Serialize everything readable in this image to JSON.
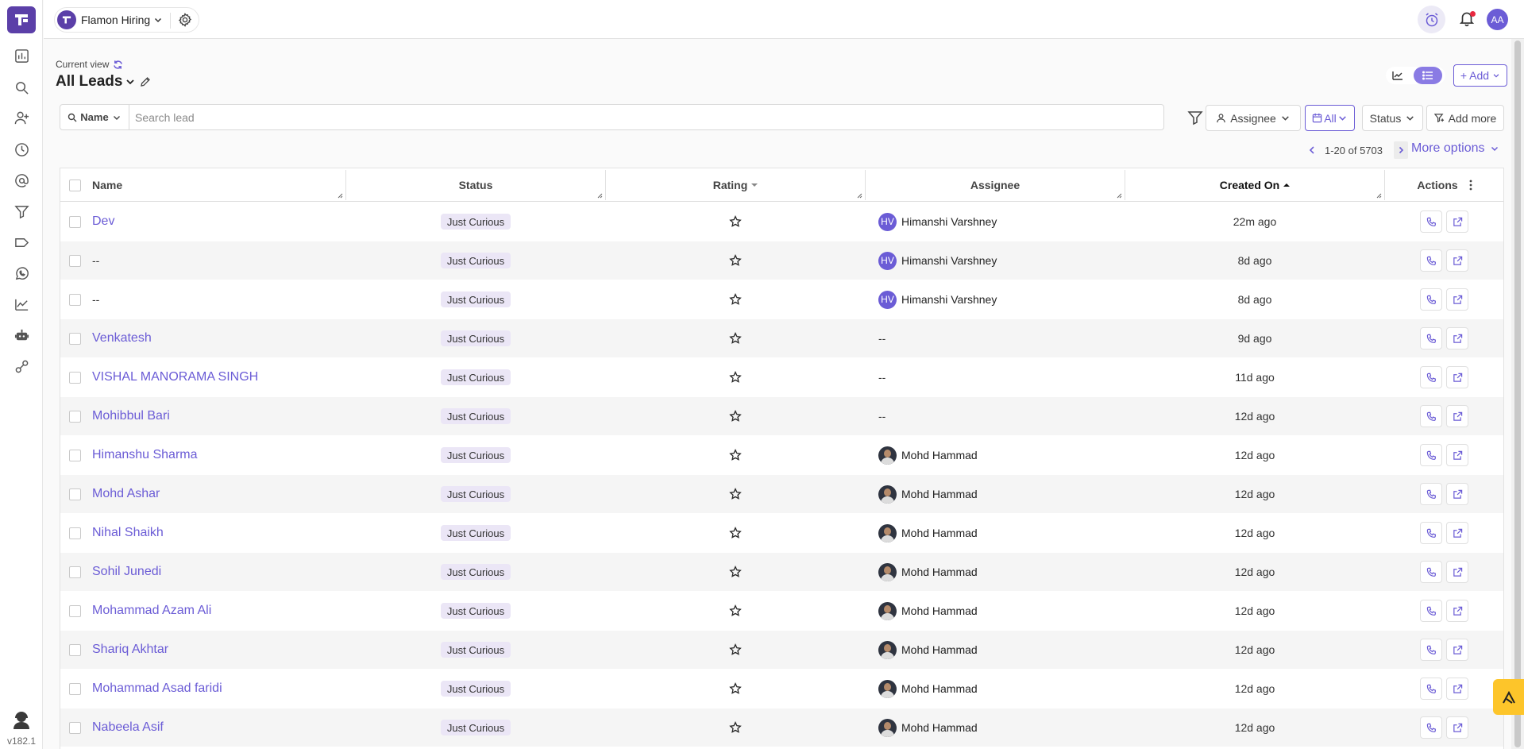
{
  "app": {
    "workspace_name": "Flamon Hiring",
    "version": "v182.1",
    "user_initials": "AA",
    "accent_color": "#6b5cd6",
    "brand_color": "#5b3fa8"
  },
  "sidebar": {
    "icons": [
      "dashboard-icon",
      "search-icon",
      "add-user-icon",
      "clock-icon",
      "at-sign-icon",
      "funnel-icon",
      "tag-icon",
      "whatsapp-icon",
      "trending-icon",
      "bot-icon",
      "integration-icon"
    ]
  },
  "view": {
    "current_view_label": "Current view",
    "title": "All Leads",
    "add_label": "+ Add"
  },
  "search": {
    "field_type": "Name",
    "placeholder": "Search lead",
    "value": ""
  },
  "filters": {
    "assignee_label": "Assignee",
    "date_label": "All",
    "status_label": "Status",
    "add_more_label": "Add more"
  },
  "pagination": {
    "range_text": "1-20 of 5703",
    "more_options_label": "More options"
  },
  "table": {
    "columns": {
      "name": "Name",
      "status": "Status",
      "rating": "Rating",
      "assignee": "Assignee",
      "created_on": "Created On",
      "actions": "Actions"
    },
    "rows": [
      {
        "name": "Dev",
        "is_link": true,
        "status": "Just Curious",
        "assignee": "Himanshi Varshney",
        "avatar": "HV",
        "created": "22m ago"
      },
      {
        "name": "--",
        "is_link": false,
        "status": "Just Curious",
        "assignee": "Himanshi Varshney",
        "avatar": "HV",
        "created": "8d ago"
      },
      {
        "name": "--",
        "is_link": false,
        "status": "Just Curious",
        "assignee": "Himanshi Varshney",
        "avatar": "HV",
        "created": "8d ago"
      },
      {
        "name": "Venkatesh",
        "is_link": true,
        "status": "Just Curious",
        "assignee": "--",
        "avatar": "",
        "created": "9d ago"
      },
      {
        "name": "VISHAL MANORAMA SINGH",
        "is_link": true,
        "status": "Just Curious",
        "assignee": "--",
        "avatar": "",
        "created": "11d ago"
      },
      {
        "name": "Mohibbul Bari",
        "is_link": true,
        "status": "Just Curious",
        "assignee": "--",
        "avatar": "",
        "created": "12d ago"
      },
      {
        "name": "Himanshu Sharma",
        "is_link": true,
        "status": "Just Curious",
        "assignee": "Mohd Hammad",
        "avatar": "photo",
        "created": "12d ago"
      },
      {
        "name": "Mohd Ashar",
        "is_link": true,
        "status": "Just Curious",
        "assignee": "Mohd Hammad",
        "avatar": "photo",
        "created": "12d ago"
      },
      {
        "name": "Nihal Shaikh",
        "is_link": true,
        "status": "Just Curious",
        "assignee": "Mohd Hammad",
        "avatar": "photo",
        "created": "12d ago"
      },
      {
        "name": "Sohil Junedi",
        "is_link": true,
        "status": "Just Curious",
        "assignee": "Mohd Hammad",
        "avatar": "photo",
        "created": "12d ago"
      },
      {
        "name": "Mohammad Azam Ali",
        "is_link": true,
        "status": "Just Curious",
        "assignee": "Mohd Hammad",
        "avatar": "photo",
        "created": "12d ago"
      },
      {
        "name": "Shariq Akhtar",
        "is_link": true,
        "status": "Just Curious",
        "assignee": "Mohd Hammad",
        "avatar": "photo",
        "created": "12d ago"
      },
      {
        "name": "Mohammad Asad faridi",
        "is_link": true,
        "status": "Just Curious",
        "assignee": "Mohd Hammad",
        "avatar": "photo",
        "created": "12d ago"
      },
      {
        "name": "Nabeela Asif",
        "is_link": true,
        "status": "Just Curious",
        "assignee": "Mohd Hammad",
        "avatar": "photo",
        "created": "12d ago"
      }
    ]
  }
}
